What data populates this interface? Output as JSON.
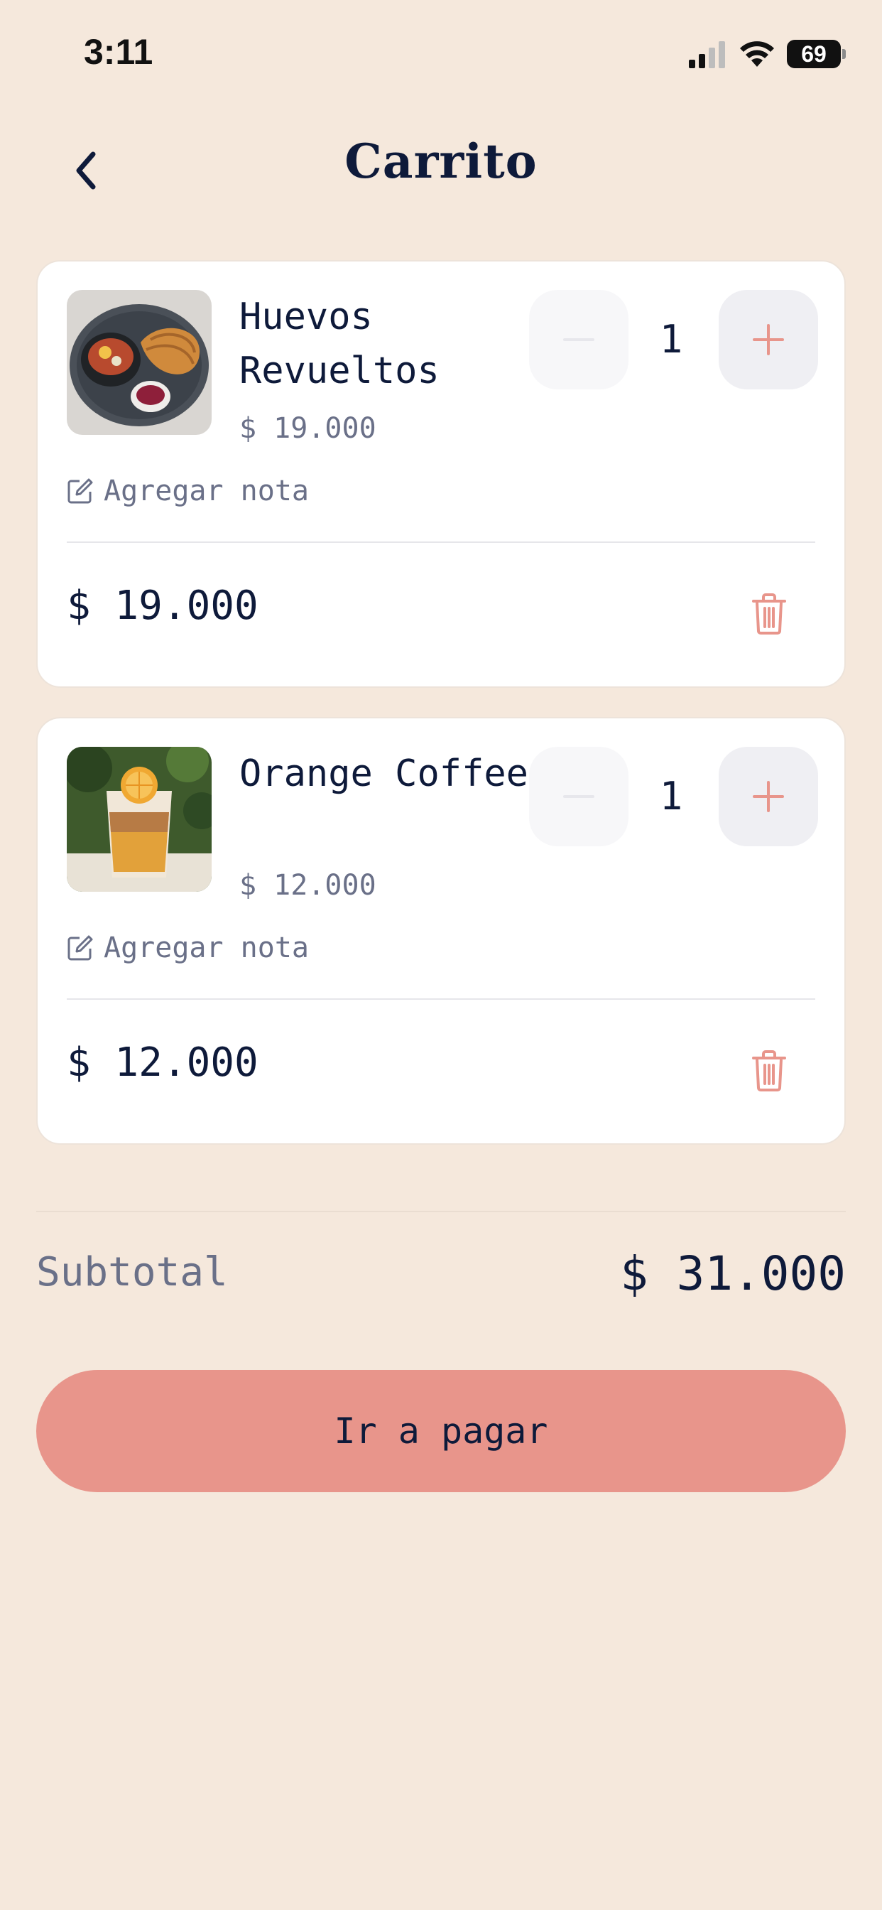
{
  "status_bar": {
    "time": "3:11",
    "battery": "69"
  },
  "header": {
    "title": "Carrito"
  },
  "cart_items": [
    {
      "name": "Huevos Revueltos",
      "price": "$ 19.000",
      "quantity": "1",
      "note_label": "Agregar nota",
      "line_total": "$ 19.000"
    },
    {
      "name": "Orange Coffee",
      "price": "$ 12.000",
      "quantity": "1",
      "note_label": "Agregar nota",
      "line_total": "$ 12.000"
    }
  ],
  "summary": {
    "subtotal_label": "Subtotal",
    "subtotal_value": "$ 31.000"
  },
  "checkout": {
    "button_label": "Ir a pagar"
  },
  "colors": {
    "background": "#F5E8DC",
    "accent": "#E8958B",
    "text": "#0E1A3A",
    "muted": "#6A7088"
  }
}
